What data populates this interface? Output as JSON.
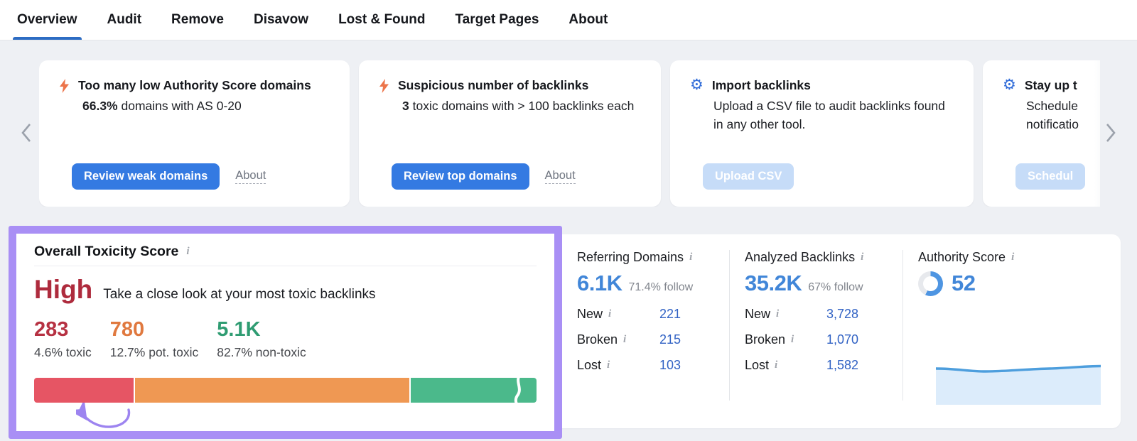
{
  "tabs": [
    {
      "label": "Overview",
      "active": true
    },
    {
      "label": "Audit",
      "active": false
    },
    {
      "label": "Remove",
      "active": false
    },
    {
      "label": "Disavow",
      "active": false
    },
    {
      "label": "Lost & Found",
      "active": false
    },
    {
      "label": "Target Pages",
      "active": false
    },
    {
      "label": "About",
      "active": false
    }
  ],
  "icons": {
    "info": "i",
    "lightning": "lightning-bolt",
    "gear": "⚙"
  },
  "carousel": {
    "cards": [
      {
        "icon": "lightning-bolt",
        "title": "Too many low Authority Score domains",
        "desc_strong": "66.3%",
        "desc_rest": " domains with AS 0-20",
        "button": "Review weak domains",
        "link": "About"
      },
      {
        "icon": "lightning-bolt",
        "title": "Suspicious number of backlinks",
        "desc_strong": "3",
        "desc_rest": " toxic domains with > 100 backlinks each",
        "button": "Review top domains",
        "link": "About"
      },
      {
        "icon": "gear",
        "title": "Import backlinks",
        "desc_strong": "",
        "desc_rest": "Upload a CSV file to audit backlinks found in any other tool.",
        "button_disabled": "Upload CSV"
      },
      {
        "icon": "gear",
        "title": "Stay up t",
        "desc_strong": "",
        "desc_rest": "Schedule notificatio",
        "button_disabled": "Schedul"
      }
    ]
  },
  "toxicity": {
    "title": "Overall Toxicity Score",
    "level": "High",
    "subtitle": "Take a close look at your most toxic backlinks",
    "stats": [
      {
        "value": "283",
        "label": "4.6% toxic"
      },
      {
        "value": "780",
        "label": "12.7% pot. toxic"
      },
      {
        "value": "5.1K",
        "label": "82.7% non-toxic"
      }
    ],
    "bar_segments": [
      {
        "name": "toxic",
        "pct": 20.1,
        "color": "#e65564"
      },
      {
        "name": "pot-toxic",
        "pct": 54.9,
        "color": "#ef9853"
      },
      {
        "name": "non-toxic",
        "pct": 25.0,
        "color": "#4bb98b"
      }
    ]
  },
  "metrics": {
    "columns": [
      {
        "title": "Referring Domains",
        "value": "6.1K",
        "follow": "71.4% follow",
        "rows": [
          {
            "label": "New",
            "value": "221"
          },
          {
            "label": "Broken",
            "value": "215"
          },
          {
            "label": "Lost",
            "value": "103"
          }
        ]
      },
      {
        "title": "Analyzed Backlinks",
        "value": "35.2K",
        "follow": "67% follow",
        "rows": [
          {
            "label": "New",
            "value": "3,728"
          },
          {
            "label": "Broken",
            "value": "1,070"
          },
          {
            "label": "Lost",
            "value": "1,582"
          }
        ]
      },
      {
        "title": "Authority Score",
        "value": "52",
        "donut_pct": 57
      }
    ]
  },
  "colors": {
    "accent_blue": "#347ae2",
    "tab_underline": "#2d6cc3",
    "big_number_blue": "#4186d8",
    "row_value_blue": "#3162c4",
    "toxic_red": "#b63142",
    "pot_toxic_orange": "#e0793f",
    "non_toxic_green": "#2f9c72",
    "highlight_purple": "#a98ff5",
    "bolt_orange": "#ec744a",
    "gear_blue": "#2f6bd8"
  }
}
